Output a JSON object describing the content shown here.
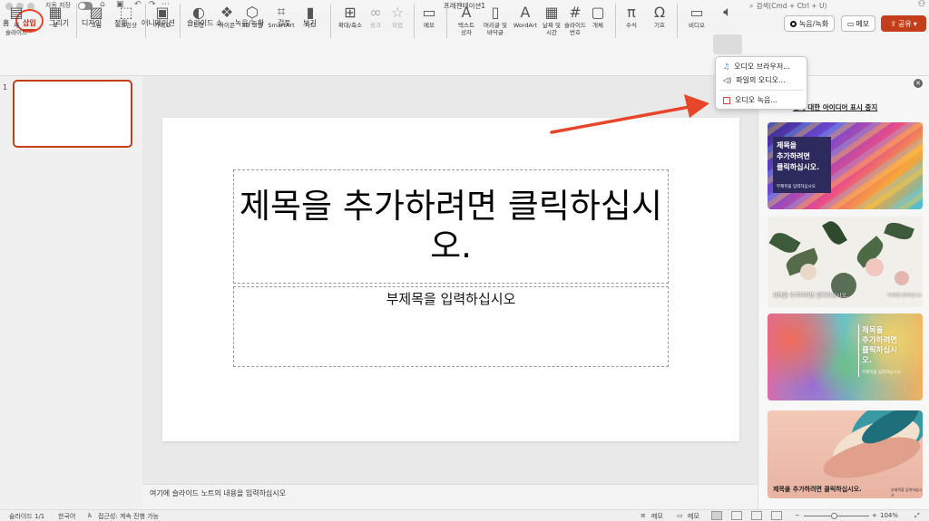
{
  "titlebar": {
    "autosave_label": "자동 저장",
    "doc_title": "프레젠테이션1",
    "search_label": "검색(Cmd + Ctrl + U)"
  },
  "tabs": [
    {
      "label": "홈"
    },
    {
      "label": "삽입"
    },
    {
      "label": "그리기"
    },
    {
      "label": "디자인"
    },
    {
      "label": "전환"
    },
    {
      "label": "애니메이션"
    },
    {
      "label": "슬라이드 쇼"
    },
    {
      "label": "녹음/녹화"
    },
    {
      "label": "검토"
    },
    {
      "label": "보기"
    }
  ],
  "header_buttons": {
    "record": "녹음/녹화",
    "memo": "메모",
    "share": "공유"
  },
  "ribbon": {
    "new_slide": "새\n슬라이드",
    "table": "표",
    "picture": "그림",
    "screenshot": "스크린샷",
    "cameo": "카메오",
    "shapes": "도형",
    "icons": "아이콘",
    "models3d": "3D 모델",
    "smartart": "SmartArt",
    "chart": "차트",
    "zoom": "확대/축소",
    "link": "링크",
    "action": "작업",
    "comment": "메모",
    "textbox": "텍스트\n상자",
    "header_footer": "머리글 및\n바닥글",
    "wordart": "WordArt",
    "date_time": "날짜 및\n시간",
    "slide_number": "슬라이드\n번호",
    "object": "개체",
    "equation": "수식",
    "symbol": "기호",
    "video": "비디오"
  },
  "audio_menu": {
    "browser": "오디오 브라우저...",
    "from_file": "파일의 오디오...",
    "record": "오디오 녹음..."
  },
  "slides_pane": {
    "number": "1"
  },
  "slide": {
    "title_placeholder": "제목을 추가하려면 클릭하십시오.",
    "subtitle_placeholder": "부제목을 입력하십시오"
  },
  "notes": {
    "placeholder": "여기에 슬라이드 노트의 내용을 입력하십시오"
  },
  "designer": {
    "header": "선에 대한 아이디어 표시 중지",
    "card1_title": "제목을\n추가하려면\n클릭하십시오.",
    "card1_sub": "부제목을 입력하십시오",
    "card2_title": "제목을 추가하려면 클릭하십시오.",
    "card2_sub": "부제목을 입력하십시오",
    "card3_title": "제목을\n추가하려면\n클릭하십시\n오.",
    "card3_sub": "부제목을 입력하십시오",
    "card4_title": "제목을 추가하려면 클릭하십시오.",
    "card4_sub": "부제목을 입력하십시오"
  },
  "statusbar": {
    "slide_count": "슬라이드 1/1",
    "language": "한국어",
    "accessibility": "접근성: 계속 진행 가능",
    "notes": "메모",
    "comments": "메모",
    "zoom": "104%"
  },
  "colors": {
    "accent": "#c43e1c",
    "annotation": "#e8462a"
  }
}
